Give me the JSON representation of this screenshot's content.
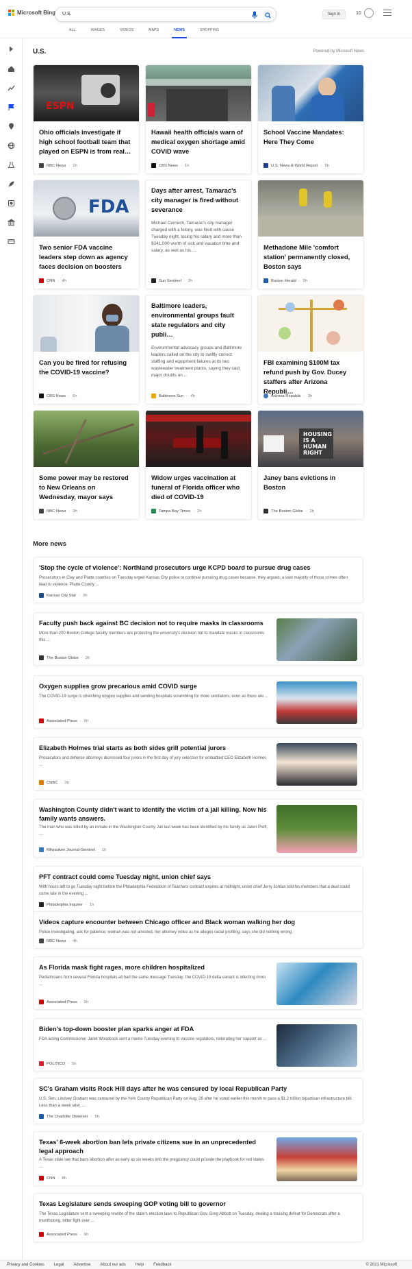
{
  "header": {
    "logo_text": "Microsoft Bing",
    "search_value": "U.S.",
    "sign_in": "Sign in",
    "rewards_count": "10",
    "tabs": [
      "ALL",
      "IMAGES",
      "VIDEOS",
      "MAPS",
      "NEWS",
      "SHOPPING"
    ],
    "active_tab": "NEWS"
  },
  "section": {
    "title": "U.S.",
    "powered_by": "Powered by Microsoft News"
  },
  "cards": [
    {
      "title": "Ohio officials investigate if high school football team that played on ESPN is from real…",
      "snippet": "",
      "source": "NBC News",
      "time": "1h",
      "src_color": "#444444"
    },
    {
      "title": "Hawaii health officials warn of medical oxygen shortage amid COVID wave",
      "snippet": "",
      "source": "CBS News",
      "time": "1h",
      "src_color": "#111111"
    },
    {
      "title": "School Vaccine Mandates: Here They Come",
      "snippet": "",
      "source": "U.S. News & World Report",
      "time": "5h",
      "src_color": "#1c3f94"
    },
    {
      "title": "Two senior FDA vaccine leaders step down as agency faces decision on boosters",
      "snippet": "",
      "source": "CNN",
      "time": "4h",
      "src_color": "#cc0000"
    },
    {
      "title": "Days after arrest, Tamarac's city manager is fired without severance",
      "snippet": "Michael Cernech, Tamarac's city manager charged with a felony, was fired with cause Tuesday night, losing his salary and more than $341,000 worth of sick and vacation time and salary, as well as his ...",
      "source": "Sun Sentinel",
      "time": "2h",
      "src_color": "#222222"
    },
    {
      "title": "Methadone Mile 'comfort station' permanently closed, Boston says",
      "snippet": "",
      "source": "Boston Herald",
      "time": "2h",
      "src_color": "#1f5fa8"
    },
    {
      "title": "Can you be fired for refusing the COVID-19 vaccine?",
      "snippet": "",
      "source": "CBS News",
      "time": "6h",
      "src_color": "#111111"
    },
    {
      "title": "Baltimore leaders, environmental groups fault state regulators and city publi…",
      "snippet": "Environmental advocacy groups and Baltimore leaders called on the city to swiftly correct staffing and equipment failures at its two wastewater treatment plants, saying they cast major doubts on ...",
      "source": "Baltimore Sun",
      "time": "4h",
      "src_color": "#e8a800"
    },
    {
      "title": "FBI examining $100M tax refund push by Gov. Ducey staffers after Arizona Republi…",
      "snippet": "",
      "source": "Arizona Republic",
      "time": "3h",
      "src_color": "#3a78c2"
    },
    {
      "title": "Some power may be restored to New Orleans on Wednesday, mayor says",
      "snippet": "",
      "source": "NBC News",
      "time": "3h",
      "src_color": "#444444"
    },
    {
      "title": "Widow urges vaccination at funeral of Florida officer who died of COVID-19",
      "snippet": "",
      "source": "Tampa Bay Times",
      "time": "2h",
      "src_color": "#2a8a5a"
    },
    {
      "title": "Janey bans evictions in Boston",
      "snippet": "",
      "source": "The Boston Globe",
      "time": "2h",
      "src_color": "#333333"
    }
  ],
  "more_news": {
    "title": "More news",
    "items": [
      {
        "title": "'Stop the cycle of violence': Northland prosecutors urge KCPD board to pursue drug cases",
        "snippet": "Prosecutors in Clay and Platte counties on Tuesday urged Kansas City police to continue pursuing drug cases because, they argued, a vast majority of those crimes often lead to violence. Platte County ...",
        "source": "Kansas City Star",
        "time": "3h",
        "src_color": "#1c4d8c",
        "thumb": ""
      },
      {
        "title": "Faculty push back against BC decision not to require masks in classrooms",
        "snippet": "More than 200 Boston College faculty members are protesting the university's decision not to mandate masks in classrooms this ...",
        "source": "The Boston Globe",
        "time": "3h",
        "src_color": "#333333",
        "thumb": "campus"
      },
      {
        "title": "Oxygen supplies grow precarious amid COVID surge",
        "snippet": "The COVID-19 surge is stretching oxygen supplies and sending hospitals scrambling for more ventilators, even as there are ...",
        "source": "Associated Press",
        "time": "6h",
        "src_color": "#cc0000",
        "thumb": "hospital"
      },
      {
        "title": "Elizabeth Holmes trial starts as both sides grill potential jurors",
        "snippet": "Prosecutors and defense attorneys dismissed four jurors in the first day of jury selection for embattled CEO Elizabeth Holmes ...",
        "source": "CNBC",
        "time": "3h",
        "src_color": "#e07b00",
        "thumb": "crowd"
      },
      {
        "title": "Washington County didn't want to identify the victim of a jail killing. Now his family wants answers.",
        "snippet": "The man who was killed by an inmate in the Washington County Jail last week has been identified by his family as Jalen Proft, ...",
        "source": "Milwaukee Journal-Sentinel",
        "time": "1h",
        "src_color": "#3a78c2",
        "thumb": "portrait"
      },
      {
        "title": "PFT contract could come Tuesday night, union chief says",
        "snippet": "With hours left to go Tuesday night before the Philadelphia Federation of Teachers contract expires at midnight, union chief Jerry Jordan told his members that a deal could come late in the evening ...",
        "source": "Philadelphia Inquirer",
        "time": "1h",
        "src_color": "#222222",
        "thumb": ""
      },
      {
        "title": "Videos capture encounter between Chicago officer and Black woman walking her dog",
        "snippet": "Police investigating, ask for patience; woman was not arrested, her attorney notes as he alleges racial profiling, says she did nothing wrong.",
        "source": "NBC News",
        "time": "4h",
        "src_color": "#444444",
        "thumb": ""
      },
      {
        "title": "As Florida mask fight rages, more children hospitalized",
        "snippet": "Pediatricians from several Florida hospitals all had the same message Tuesday: the COVID-19 delta variant is infecting more ...",
        "source": "Associated Press",
        "time": "5h",
        "src_color": "#cc0000",
        "thumb": "test"
      },
      {
        "title": "Biden's top-down booster plan sparks anger at FDA",
        "snippet": "FDA acting Commissioner Janet Woodcock sent a memo Tuesday evening to vaccine regulators, reiterating her support as ...",
        "source": "POLITICO",
        "time": "5h",
        "src_color": "#d4202a",
        "thumb": "vaccine"
      },
      {
        "title": "SC's Graham visits Rock Hill days after he was censured by local Republican Party",
        "snippet": "U.S. Sen. Lindsey Graham was censured by the York County Republican Party on Aug. 26 after he voted earlier this month to pass a $1.2 trillion bipartisan infrastructure bill. Less than a week later, ...",
        "source": "The Charlotte Observer",
        "time": "5h",
        "src_color": "#1c5fa8",
        "thumb": ""
      },
      {
        "title": "Texas' 6-week abortion ban lets private citizens sue in an unprecedented legal approach",
        "snippet": "A Texas state law that bans abortion after as early as six weeks into the pregnancy could provide the playbook for red states ...",
        "source": "CNN",
        "time": "8h",
        "src_color": "#cc0000",
        "thumb": "protest"
      },
      {
        "title": "Texas Legislature sends sweeping GOP voting bill to governor",
        "snippet": "The Texas Legislature sent a sweeping rewrite of the state's election laws to Republican Gov. Greg Abbott on Tuesday, dealing a bruising defeat for Democrats after a monthslong, bitter fight over ...",
        "source": "Associated Press",
        "time": "9h",
        "src_color": "#cc0000",
        "thumb": ""
      }
    ]
  },
  "footer": {
    "links": [
      "Privacy and Cookies",
      "Legal",
      "Advertise",
      "About our ads",
      "Help",
      "Feedback"
    ],
    "copyright": "© 2021 Microsoft"
  }
}
